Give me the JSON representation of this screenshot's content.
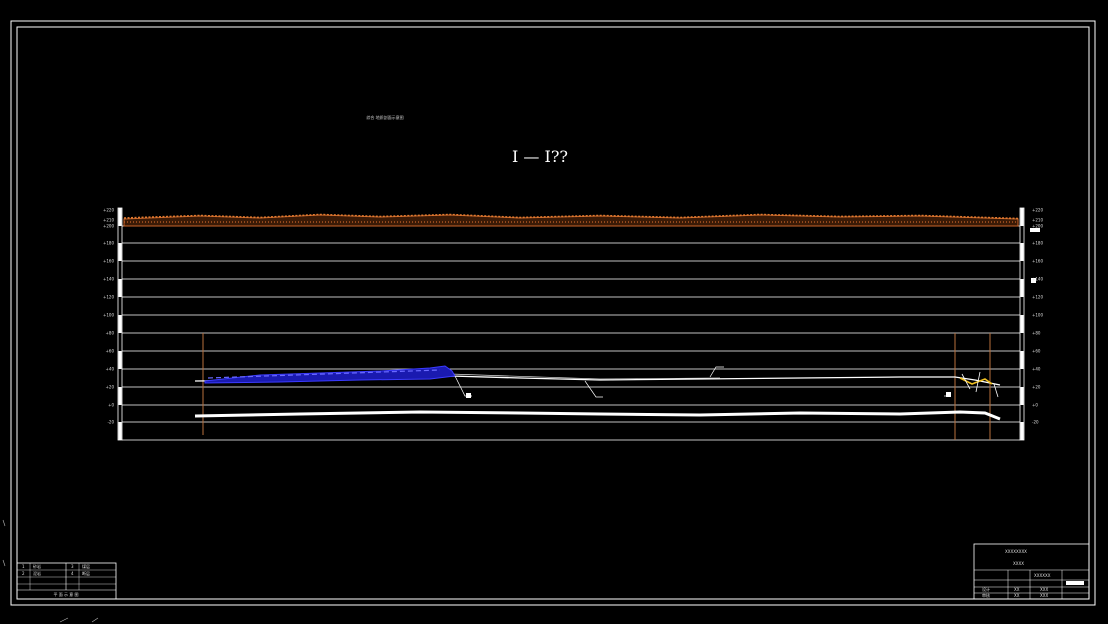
{
  "drawing": {
    "small_title": "综合 地质剖面示意图",
    "section_title": "I — I??"
  },
  "elevation_labels_left": [
    "+220",
    "+210",
    "+200",
    "+180",
    "+160",
    "+140",
    "+120",
    "+100",
    "+80",
    "+60",
    "+40",
    "+20",
    "+0",
    "-20"
  ],
  "elevation_labels_right": [
    "+220",
    "+210",
    "+200",
    "+180",
    "+160",
    "+140",
    "+120",
    "+100",
    "+80",
    "+60",
    "+40",
    "+20",
    "+0",
    "-20"
  ],
  "legend_table": {
    "footer": "平 面 示 意 图",
    "rows": [
      [
        "1",
        "砂岩"
      ],
      [
        "2",
        "泥岩"
      ],
      [
        "3",
        "煤层"
      ],
      [
        "4",
        "断层"
      ]
    ]
  },
  "title_block": {
    "project": "XXXXXXXX",
    "drawing_name": "XXXX",
    "drawing_no": "XXXXXX",
    "rows": [
      [
        "设计",
        "XX",
        "XXX"
      ],
      [
        "审核",
        "XX",
        "XXX"
      ]
    ]
  },
  "colors": {
    "background": "#000000",
    "frame": "#ffffff",
    "ground_fill": "#c8642a",
    "marker_line": "#b8703c",
    "coal_seam": "#2a2aff",
    "highlight": "#f0c020"
  }
}
